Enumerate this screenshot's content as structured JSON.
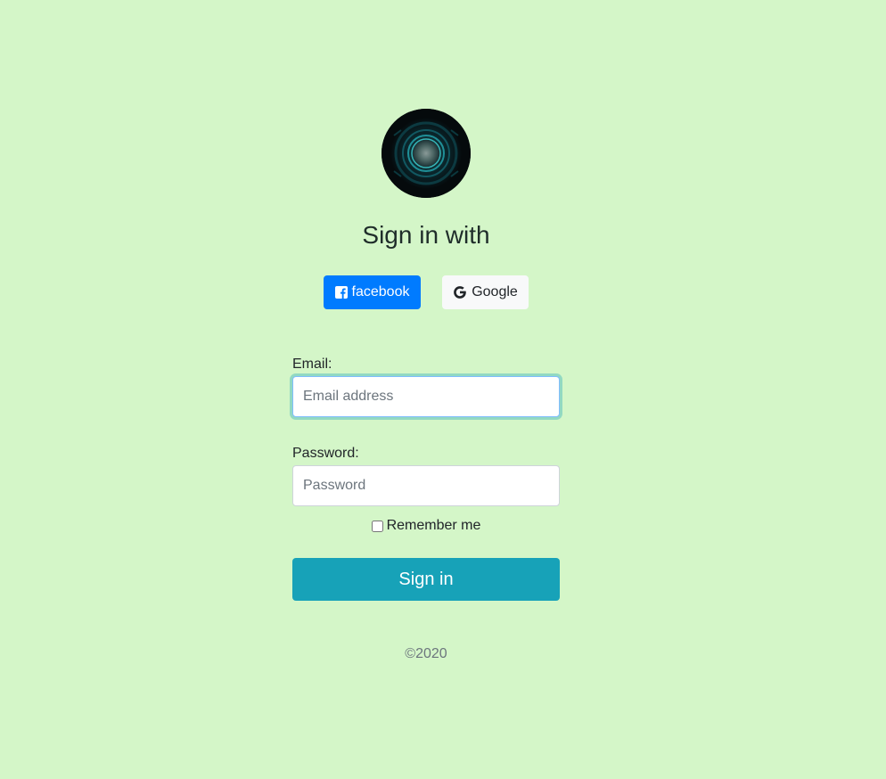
{
  "page": {
    "logo_icon": "glowing-orb-logo",
    "heading": "Sign in with",
    "background_color": "#d4f6c8"
  },
  "social": {
    "facebook": {
      "label": "facebook",
      "icon": "facebook-square-icon",
      "color": "#007bff"
    },
    "google": {
      "label": "Google",
      "icon": "google-g-icon",
      "color": "#f8f9fa"
    }
  },
  "form": {
    "email_label": "Email:",
    "email_placeholder": "Email address",
    "password_label": "Password:",
    "password_placeholder": "Password",
    "remember_label": "Remember me",
    "remember_checked": false,
    "submit_label": "Sign in",
    "submit_color": "#17a2b8"
  },
  "footer": {
    "copyright": "©2020"
  }
}
